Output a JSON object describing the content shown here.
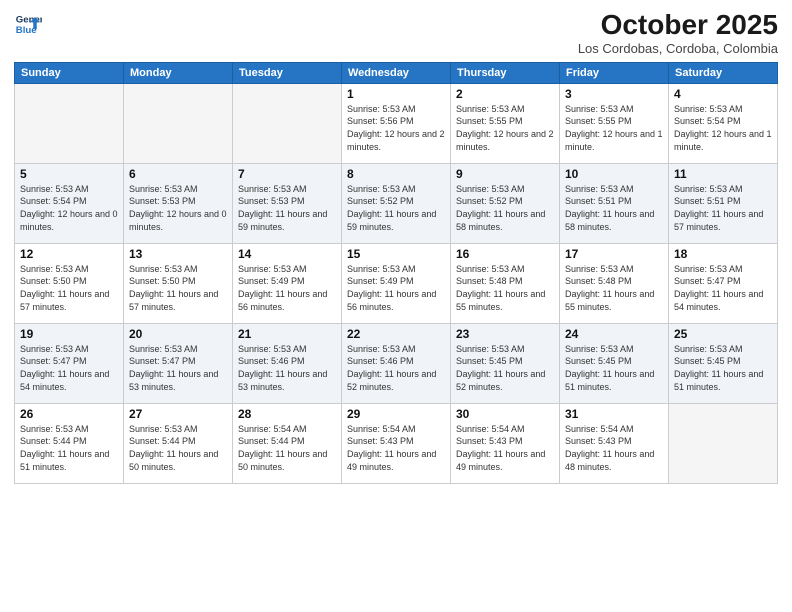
{
  "header": {
    "logo_line1": "General",
    "logo_line2": "Blue",
    "month": "October 2025",
    "location": "Los Cordobas, Cordoba, Colombia"
  },
  "weekdays": [
    "Sunday",
    "Monday",
    "Tuesday",
    "Wednesday",
    "Thursday",
    "Friday",
    "Saturday"
  ],
  "weeks": [
    [
      {
        "day": "",
        "info": ""
      },
      {
        "day": "",
        "info": ""
      },
      {
        "day": "",
        "info": ""
      },
      {
        "day": "1",
        "info": "Sunrise: 5:53 AM\nSunset: 5:56 PM\nDaylight: 12 hours\nand 2 minutes."
      },
      {
        "day": "2",
        "info": "Sunrise: 5:53 AM\nSunset: 5:55 PM\nDaylight: 12 hours\nand 2 minutes."
      },
      {
        "day": "3",
        "info": "Sunrise: 5:53 AM\nSunset: 5:55 PM\nDaylight: 12 hours\nand 1 minute."
      },
      {
        "day": "4",
        "info": "Sunrise: 5:53 AM\nSunset: 5:54 PM\nDaylight: 12 hours\nand 1 minute."
      }
    ],
    [
      {
        "day": "5",
        "info": "Sunrise: 5:53 AM\nSunset: 5:54 PM\nDaylight: 12 hours\nand 0 minutes."
      },
      {
        "day": "6",
        "info": "Sunrise: 5:53 AM\nSunset: 5:53 PM\nDaylight: 12 hours\nand 0 minutes."
      },
      {
        "day": "7",
        "info": "Sunrise: 5:53 AM\nSunset: 5:53 PM\nDaylight: 11 hours\nand 59 minutes."
      },
      {
        "day": "8",
        "info": "Sunrise: 5:53 AM\nSunset: 5:52 PM\nDaylight: 11 hours\nand 59 minutes."
      },
      {
        "day": "9",
        "info": "Sunrise: 5:53 AM\nSunset: 5:52 PM\nDaylight: 11 hours\nand 58 minutes."
      },
      {
        "day": "10",
        "info": "Sunrise: 5:53 AM\nSunset: 5:51 PM\nDaylight: 11 hours\nand 58 minutes."
      },
      {
        "day": "11",
        "info": "Sunrise: 5:53 AM\nSunset: 5:51 PM\nDaylight: 11 hours\nand 57 minutes."
      }
    ],
    [
      {
        "day": "12",
        "info": "Sunrise: 5:53 AM\nSunset: 5:50 PM\nDaylight: 11 hours\nand 57 minutes."
      },
      {
        "day": "13",
        "info": "Sunrise: 5:53 AM\nSunset: 5:50 PM\nDaylight: 11 hours\nand 57 minutes."
      },
      {
        "day": "14",
        "info": "Sunrise: 5:53 AM\nSunset: 5:49 PM\nDaylight: 11 hours\nand 56 minutes."
      },
      {
        "day": "15",
        "info": "Sunrise: 5:53 AM\nSunset: 5:49 PM\nDaylight: 11 hours\nand 56 minutes."
      },
      {
        "day": "16",
        "info": "Sunrise: 5:53 AM\nSunset: 5:48 PM\nDaylight: 11 hours\nand 55 minutes."
      },
      {
        "day": "17",
        "info": "Sunrise: 5:53 AM\nSunset: 5:48 PM\nDaylight: 11 hours\nand 55 minutes."
      },
      {
        "day": "18",
        "info": "Sunrise: 5:53 AM\nSunset: 5:47 PM\nDaylight: 11 hours\nand 54 minutes."
      }
    ],
    [
      {
        "day": "19",
        "info": "Sunrise: 5:53 AM\nSunset: 5:47 PM\nDaylight: 11 hours\nand 54 minutes."
      },
      {
        "day": "20",
        "info": "Sunrise: 5:53 AM\nSunset: 5:47 PM\nDaylight: 11 hours\nand 53 minutes."
      },
      {
        "day": "21",
        "info": "Sunrise: 5:53 AM\nSunset: 5:46 PM\nDaylight: 11 hours\nand 53 minutes."
      },
      {
        "day": "22",
        "info": "Sunrise: 5:53 AM\nSunset: 5:46 PM\nDaylight: 11 hours\nand 52 minutes."
      },
      {
        "day": "23",
        "info": "Sunrise: 5:53 AM\nSunset: 5:45 PM\nDaylight: 11 hours\nand 52 minutes."
      },
      {
        "day": "24",
        "info": "Sunrise: 5:53 AM\nSunset: 5:45 PM\nDaylight: 11 hours\nand 51 minutes."
      },
      {
        "day": "25",
        "info": "Sunrise: 5:53 AM\nSunset: 5:45 PM\nDaylight: 11 hours\nand 51 minutes."
      }
    ],
    [
      {
        "day": "26",
        "info": "Sunrise: 5:53 AM\nSunset: 5:44 PM\nDaylight: 11 hours\nand 51 minutes."
      },
      {
        "day": "27",
        "info": "Sunrise: 5:53 AM\nSunset: 5:44 PM\nDaylight: 11 hours\nand 50 minutes."
      },
      {
        "day": "28",
        "info": "Sunrise: 5:54 AM\nSunset: 5:44 PM\nDaylight: 11 hours\nand 50 minutes."
      },
      {
        "day": "29",
        "info": "Sunrise: 5:54 AM\nSunset: 5:43 PM\nDaylight: 11 hours\nand 49 minutes."
      },
      {
        "day": "30",
        "info": "Sunrise: 5:54 AM\nSunset: 5:43 PM\nDaylight: 11 hours\nand 49 minutes."
      },
      {
        "day": "31",
        "info": "Sunrise: 5:54 AM\nSunset: 5:43 PM\nDaylight: 11 hours\nand 48 minutes."
      },
      {
        "day": "",
        "info": ""
      }
    ]
  ]
}
